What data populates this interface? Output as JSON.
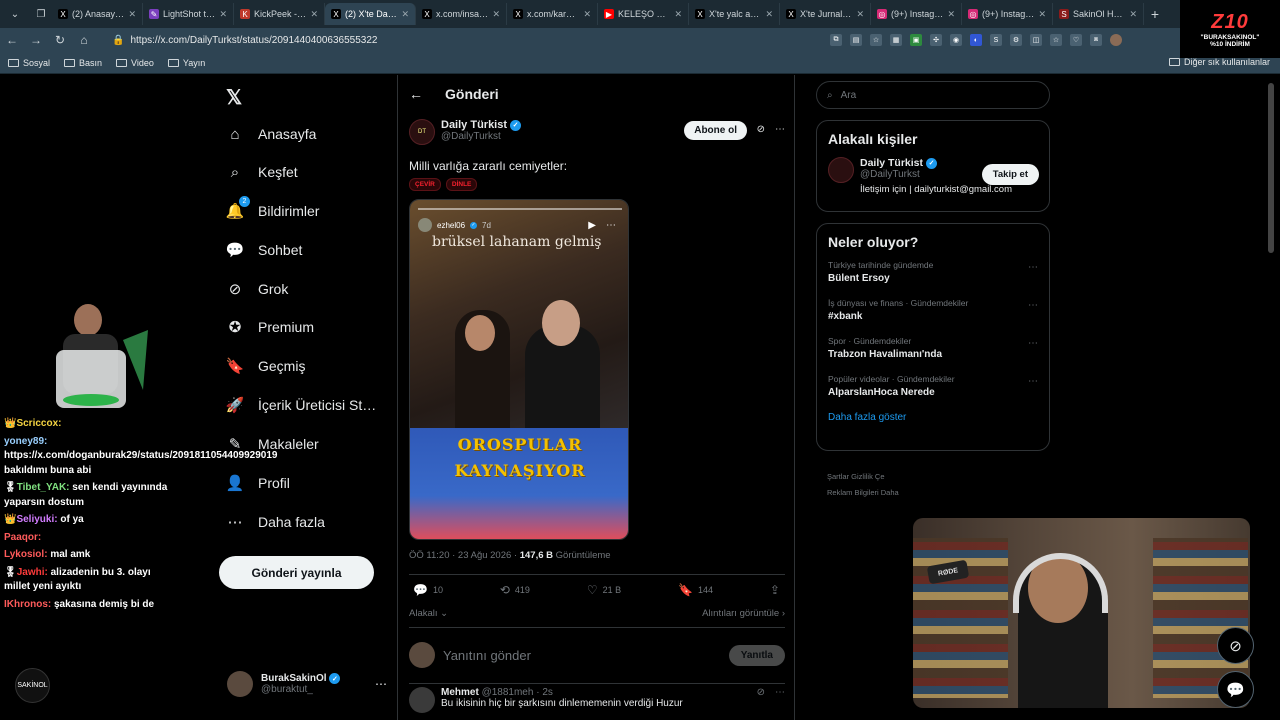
{
  "browser": {
    "tabs": [
      {
        "label": "(2) Anasayfa / X",
        "fav": "X",
        "color": "#000000"
      },
      {
        "label": "LightShot taraf…",
        "fav": "✎",
        "color": "#7b3fbf"
      },
      {
        "label": "KickPeek - Rea…",
        "fav": "K",
        "color": "#c0392b"
      },
      {
        "label": "(2) X'te Daily T…",
        "fav": "X",
        "color": "#000000"
      },
      {
        "label": "x.com/insavuc…",
        "fav": "X",
        "color": "#000000"
      },
      {
        "label": "x.com/karanov…",
        "fav": "X",
        "color": "#000000"
      },
      {
        "label": "KELEŞO & SİD…",
        "fav": "▶",
        "color": "#ff0000"
      },
      {
        "label": "X'te yalc arşiv…",
        "fav": "X",
        "color": "#000000"
      },
      {
        "label": "X'te Jurnal: \"K…",
        "fav": "X",
        "color": "#000000"
      },
      {
        "label": "(9+) Instagram",
        "fav": "◎",
        "color": "#d62976"
      },
      {
        "label": "(9+) Instagram",
        "fav": "◎",
        "color": "#d62976"
      },
      {
        "label": "SakinOl Haber",
        "fav": "S",
        "color": "#8b1a1a"
      }
    ],
    "active_tab": 3,
    "url": "https://x.com/DailyTurkst/status/2091440400636555322",
    "bookmarks": [
      "Sosyal",
      "Basın",
      "Video",
      "Yayın"
    ],
    "other_bookmarks": "Diğer sık kullanılanlar"
  },
  "overlay": {
    "logo_top": "Z10",
    "logo_line1": "\"BURAKSAKINOL\"",
    "logo_line2": "%10 İNDİRİM",
    "small_logo": "SAKİNOL",
    "mic_label": "RØDE",
    "chat": [
      {
        "user": "Scriccox:",
        "text": "",
        "color": "#f5d442",
        "badge": "👑"
      },
      {
        "user": "yoney89:",
        "text": "https://x.com/doganburak29/status/2091811054409929019 bakıldımı buna abi",
        "color": "#9ad0ff",
        "badge": ""
      },
      {
        "user": "Tibet_YAK:",
        "text": "sen kendi yayınında yaparsın dostum",
        "color": "#7fe07f",
        "badge": "🎖"
      },
      {
        "user": "Seliyuki:",
        "text": "of ya",
        "color": "#d27cff",
        "badge": "👑"
      },
      {
        "user": "Paaqor:",
        "text": "",
        "color": "#ff5b5b",
        "badge": ""
      },
      {
        "user": "Lykosiol:",
        "text": "mal amk",
        "color": "#ff5b5b",
        "badge": ""
      },
      {
        "user": "Jawhi:",
        "text": "alizadenin bu 3. olayı millet yeni ayıktı",
        "color": "#ff3b3b",
        "badge": "🎖"
      },
      {
        "user": "IKhronos:",
        "text": "şakasına demiş bi de",
        "color": "#ff5b5b",
        "badge": ""
      }
    ]
  },
  "nav": {
    "items": [
      {
        "label": "Anasayfa",
        "icon": "⌂",
        "name": "home-icon"
      },
      {
        "label": "Keşfet",
        "icon": "⌕",
        "name": "search-icon"
      },
      {
        "label": "Bildirimler",
        "icon": "🔔",
        "name": "bell-icon",
        "badge": "2"
      },
      {
        "label": "Sohbet",
        "icon": "💬",
        "name": "chat-icon"
      },
      {
        "label": "Grok",
        "icon": "⊘",
        "name": "grok-icon"
      },
      {
        "label": "Premium",
        "icon": "✪",
        "name": "premium-icon"
      },
      {
        "label": "Geçmiş",
        "icon": "🔖",
        "name": "bookmark-icon"
      },
      {
        "label": "İçerik Üreticisi St…",
        "icon": "🚀",
        "name": "rocket-icon"
      },
      {
        "label": "Makaleler",
        "icon": "✎",
        "name": "article-icon"
      },
      {
        "label": "Profil",
        "icon": "👤",
        "name": "profile-icon"
      },
      {
        "label": "Daha fazla",
        "icon": "⋯",
        "name": "more-icon"
      }
    ],
    "post_button": "Gönderi yayınla",
    "me_name": "BurakSakinOl",
    "me_handle": "@buraktut_"
  },
  "main": {
    "header": "Gönderi",
    "author_name": "Daily Türkist",
    "author_handle": "@DailyTurkst",
    "follow": "Abone ol",
    "text": "Milli varlığa zararlı cemiyetler:",
    "pills": [
      "ÇEVİR",
      "DİNLE"
    ],
    "media": {
      "ig_user": "ezhel06",
      "ig_time": "7d",
      "story_text": "brüksel lahanam gelmiş",
      "banner_line1": "OROSPULAR",
      "banner_line2": "KAYNAŞIYOR"
    },
    "timestamp": "ÖÖ 11:20 · 23 Ağu 2026 · ",
    "views": "147,6 B",
    "views_label": " Görüntüleme",
    "actions": [
      {
        "icon": "💬",
        "value": "10",
        "name": "reply-icon"
      },
      {
        "icon": "⟲",
        "value": "419",
        "name": "repost-icon"
      },
      {
        "icon": "♡",
        "value": "21 B",
        "name": "like-icon"
      },
      {
        "icon": "🔖",
        "value": "144",
        "name": "bookmark-action-icon"
      },
      {
        "icon": "⇪",
        "value": "",
        "name": "share-icon"
      }
    ],
    "related_left": "Alakalı ⌄",
    "related_right": "Alıntıları görüntüle ›",
    "reply_placeholder": "Yanıtını gönder",
    "reply_button": "Yanıtla",
    "next_post": {
      "name": "Mehmet",
      "handle": "@1881meh · 2s",
      "text": "Bu ikisinin hiç bir şarkısını dinlememenin verdiği Huzur"
    }
  },
  "right": {
    "search_placeholder": "Ara",
    "related_title": "Alakalı kişiler",
    "related_name": "Daily Türkist",
    "related_handle": "@DailyTurkst",
    "related_bio": "İletişim için | dailyturkist@gmail.com",
    "related_follow": "Takip et",
    "trends_title": "Neler oluyor?",
    "trends": [
      {
        "ctx": "Türkiye tarihinde gündemde",
        "title": "Bülent Ersoy"
      },
      {
        "ctx": "İş dünyası ve finans · Gündemdekiler",
        "title": "#xbank"
      },
      {
        "ctx": "Spor · Gündemdekiler",
        "title": "Trabzon Havalimanı'nda"
      },
      {
        "ctx": "Popüler videolar · Gündemdekiler",
        "title": "AlparslanHoca Nerede"
      }
    ],
    "show_more": "Daha fazla göster",
    "footer_line1": "Şartlar   Gizlilik   Çe",
    "footer_line2": "Reklam Bilgileri   Daha"
  }
}
